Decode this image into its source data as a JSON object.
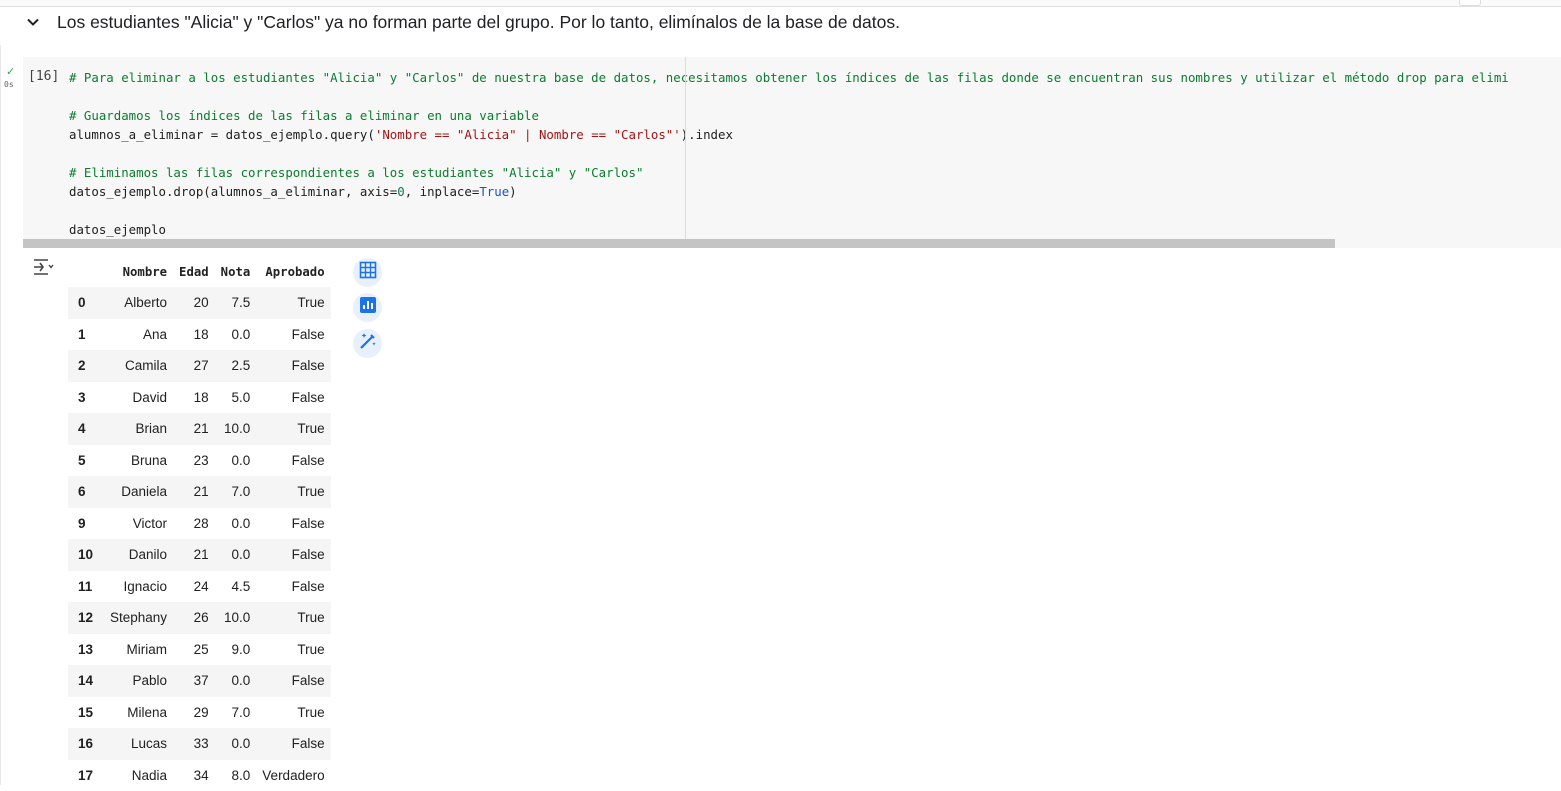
{
  "section": {
    "title": "Los estudiantes \"Alicia\" y \"Carlos\" ya no forman parte del grupo. Por lo tanto, elimínalos de la base de datos."
  },
  "cell": {
    "execution_count": "[16]",
    "run_time": "0s",
    "code_lines": [
      [
        {
          "t": "# Para eliminar a los estudiantes \"Alicia\" y \"Carlos\" de nuestra base de datos, necesitamos obtener los índices de las filas donde se encuentran sus nombres y utilizar el método drop para elimi",
          "c": "com"
        }
      ],
      [],
      [
        {
          "t": "# Guardamos los índices de las filas a eliminar en una variable",
          "c": "com"
        }
      ],
      [
        {
          "t": "alumnos_a_eliminar = datos_ejemplo.query(",
          "c": ""
        },
        {
          "t": "'Nombre == \"Alicia\" | Nombre == \"Carlos\"'",
          "c": "str"
        },
        {
          "t": ").index",
          "c": ""
        }
      ],
      [],
      [
        {
          "t": "# Eliminamos las filas correspondientes a los estudiantes \"Alicia\" y \"Carlos\"",
          "c": "com"
        }
      ],
      [
        {
          "t": "datos_ejemplo.drop(alumnos_a_eliminar, axis=",
          "c": ""
        },
        {
          "t": "0",
          "c": "num"
        },
        {
          "t": ", inplace=",
          "c": ""
        },
        {
          "t": "True",
          "c": "kw"
        },
        {
          "t": ")",
          "c": ""
        }
      ],
      [],
      [
        {
          "t": "datos_ejemplo",
          "c": ""
        }
      ]
    ]
  },
  "output": {
    "columns": [
      "",
      "Nombre",
      "Edad",
      "Nota",
      "Aprobado"
    ],
    "rows": [
      [
        "0",
        "Alberto",
        "20",
        "7.5",
        "True"
      ],
      [
        "1",
        "Ana",
        "18",
        "0.0",
        "False"
      ],
      [
        "2",
        "Camila",
        "27",
        "2.5",
        "False"
      ],
      [
        "3",
        "David",
        "18",
        "5.0",
        "False"
      ],
      [
        "4",
        "Brian",
        "21",
        "10.0",
        "True"
      ],
      [
        "5",
        "Bruna",
        "23",
        "0.0",
        "False"
      ],
      [
        "6",
        "Daniela",
        "21",
        "7.0",
        "True"
      ],
      [
        "9",
        "Victor",
        "28",
        "0.0",
        "False"
      ],
      [
        "10",
        "Danilo",
        "21",
        "0.0",
        "False"
      ],
      [
        "11",
        "Ignacio",
        "24",
        "4.5",
        "False"
      ],
      [
        "12",
        "Stephany",
        "26",
        "10.0",
        "True"
      ],
      [
        "13",
        "Miriam",
        "25",
        "9.0",
        "True"
      ],
      [
        "14",
        "Pablo",
        "37",
        "0.0",
        "False"
      ],
      [
        "15",
        "Milena",
        "29",
        "7.0",
        "True"
      ],
      [
        "16",
        "Lucas",
        "33",
        "0.0",
        "False"
      ],
      [
        "17",
        "Nadia",
        "34",
        "8.0",
        "Verdadero"
      ]
    ],
    "tools": [
      "table-icon",
      "chart-icon",
      "magic-wand-icon"
    ]
  },
  "colors": {
    "comment": "#0b7c2f",
    "string": "#a31515",
    "keyword": "#1a52c7",
    "accent": "#1a73e8"
  }
}
